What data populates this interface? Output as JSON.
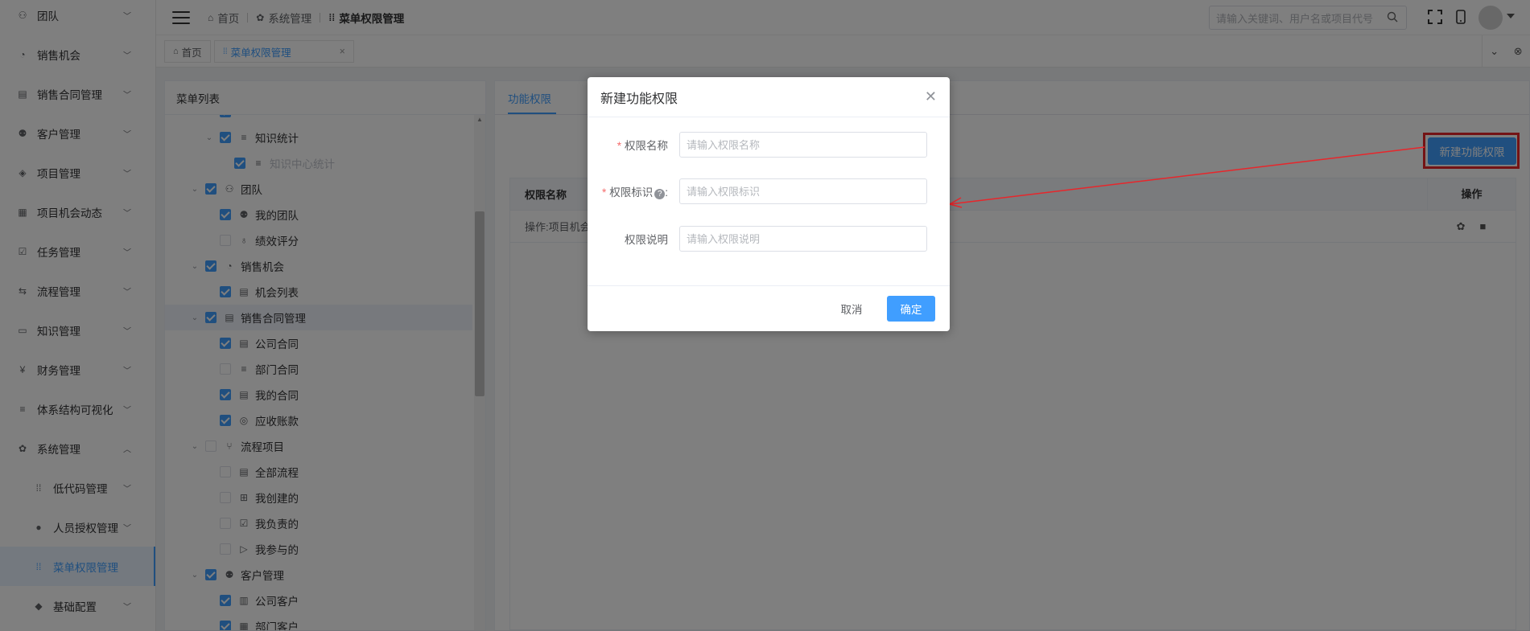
{
  "sidebar": {
    "items": [
      {
        "label": "团队",
        "icon": "team-icon",
        "glyph": "⚇",
        "chevron": "down"
      },
      {
        "label": "销售机会",
        "icon": "pie-chart-icon",
        "glyph": "◔",
        "chevron": "down"
      },
      {
        "label": "销售合同管理",
        "icon": "contract-icon",
        "glyph": "▤",
        "chevron": "down"
      },
      {
        "label": "客户管理",
        "icon": "customer-icon",
        "glyph": "⚉",
        "chevron": "down"
      },
      {
        "label": "项目管理",
        "icon": "layers-icon",
        "glyph": "◈",
        "chevron": "down"
      },
      {
        "label": "项目机会动态",
        "icon": "calendar-icon",
        "glyph": "▦",
        "chevron": "down"
      },
      {
        "label": "任务管理",
        "icon": "task-icon",
        "glyph": "☑",
        "chevron": "down"
      },
      {
        "label": "流程管理",
        "icon": "flow-icon",
        "glyph": "⇆",
        "chevron": "down"
      },
      {
        "label": "知识管理",
        "icon": "book-icon",
        "glyph": "▭",
        "chevron": "down"
      },
      {
        "label": "财务管理",
        "icon": "finance-icon",
        "glyph": "¥",
        "chevron": "down"
      },
      {
        "label": "体系结构可视化",
        "icon": "list-icon",
        "glyph": "≡",
        "chevron": "down"
      },
      {
        "label": "系统管理",
        "icon": "gear-icon",
        "glyph": "✿",
        "chevron": "up"
      },
      {
        "label": "低代码管理",
        "icon": "grid-icon",
        "glyph": "⁞⁞",
        "chevron": "down",
        "sub": true
      },
      {
        "label": "人员授权管理",
        "icon": "user-icon",
        "glyph": "●",
        "chevron": "down",
        "sub": true
      },
      {
        "label": "菜单权限管理",
        "icon": "grid-icon",
        "glyph": "⁞⁞",
        "chevron": "",
        "sub": true,
        "active": true
      },
      {
        "label": "基础配置",
        "icon": "cube-icon",
        "glyph": "◆",
        "chevron": "down",
        "sub": true
      }
    ]
  },
  "header": {
    "breadcrumb": {
      "home": "首页",
      "system": "系统管理",
      "current": "菜单权限管理"
    },
    "search_placeholder": "请输入关键词、用户名或项目代号"
  },
  "tags": {
    "home": "首页",
    "current": "菜单权限管理"
  },
  "tree": {
    "title": "菜单列表",
    "nodes": [
      {
        "label": "",
        "level": 1,
        "checked": true,
        "arrow": "",
        "glyph": ""
      },
      {
        "label": "知识统计",
        "level": 1,
        "checked": true,
        "arrow": "⌄",
        "glyph": "≡"
      },
      {
        "label": "知识中心统计",
        "level": 2,
        "checked": true,
        "arrow": "",
        "glyph": "≡",
        "dim": true
      },
      {
        "label": "团队",
        "level": 0,
        "checked": true,
        "arrow": "⌄",
        "glyph": "⚇"
      },
      {
        "label": "我的团队",
        "level": 1,
        "checked": true,
        "arrow": "",
        "glyph": "⚉"
      },
      {
        "label": "绩效评分",
        "level": 1,
        "checked": false,
        "arrow": "",
        "glyph": "♁"
      },
      {
        "label": "销售机会",
        "level": 0,
        "checked": true,
        "arrow": "⌄",
        "glyph": "◔"
      },
      {
        "label": "机会列表",
        "level": 1,
        "checked": true,
        "arrow": "",
        "glyph": "▤"
      },
      {
        "label": "销售合同管理",
        "level": 0,
        "checked": true,
        "arrow": "⌄",
        "glyph": "▤",
        "hl": true
      },
      {
        "label": "公司合同",
        "level": 1,
        "checked": true,
        "arrow": "",
        "glyph": "▤"
      },
      {
        "label": "部门合同",
        "level": 1,
        "checked": false,
        "arrow": "",
        "glyph": "≡"
      },
      {
        "label": "我的合同",
        "level": 1,
        "checked": true,
        "arrow": "",
        "glyph": "▤"
      },
      {
        "label": "应收账款",
        "level": 1,
        "checked": true,
        "arrow": "",
        "glyph": "◎"
      },
      {
        "label": "流程项目",
        "level": 0,
        "checked": false,
        "arrow": "⌄",
        "glyph": "⑂"
      },
      {
        "label": "全部流程",
        "level": 1,
        "checked": false,
        "arrow": "",
        "glyph": "▤"
      },
      {
        "label": "我创建的",
        "level": 1,
        "checked": false,
        "arrow": "",
        "glyph": "⊞"
      },
      {
        "label": "我负责的",
        "level": 1,
        "checked": false,
        "arrow": "",
        "glyph": "☑"
      },
      {
        "label": "我参与的",
        "level": 1,
        "checked": false,
        "arrow": "",
        "glyph": "▷"
      },
      {
        "label": "客户管理",
        "level": 0,
        "checked": true,
        "arrow": "⌄",
        "glyph": "⚉"
      },
      {
        "label": "公司客户",
        "level": 1,
        "checked": true,
        "arrow": "",
        "glyph": "▥"
      },
      {
        "label": "部门客户",
        "level": 1,
        "checked": true,
        "arrow": "",
        "glyph": "▦"
      }
    ]
  },
  "panel": {
    "tab_active": "功能权限",
    "new_button": "新建功能权限",
    "table": {
      "col_name": "权限名称",
      "col_ops": "操作",
      "rows": [
        {
          "name": "操作:项目机会"
        }
      ]
    }
  },
  "modal": {
    "title": "新建功能权限",
    "fields": {
      "name": {
        "label": "权限名称",
        "placeholder": "请输入权限名称",
        "required": "*"
      },
      "key": {
        "label": "权限标识",
        "placeholder": "请输入权限标识",
        "required": "*",
        "help": "?",
        "suffix": ":"
      },
      "desc": {
        "label": "权限说明",
        "placeholder": "请输入权限说明"
      }
    },
    "cancel": "取消",
    "ok": "确定"
  },
  "colors": {
    "primary": "#409eff",
    "annotation_red": "#e8262b"
  }
}
